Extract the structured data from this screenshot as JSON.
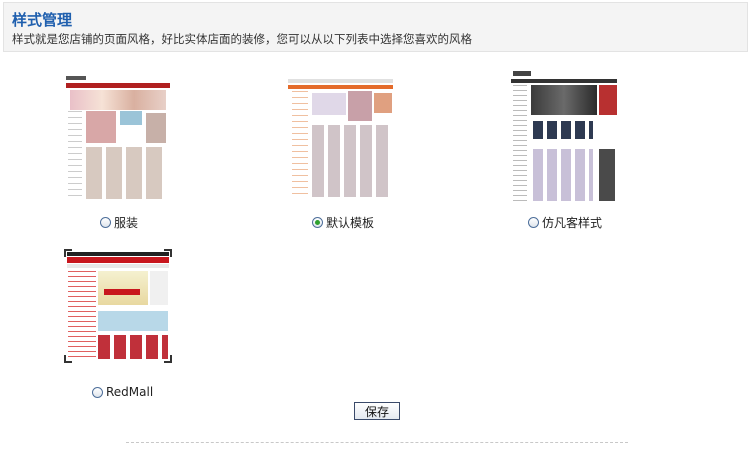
{
  "header": {
    "title": "样式管理",
    "subtitle": "样式就是您店铺的页面风格，好比实体店面的装修，您可以从以下列表中选择您喜欢的风格"
  },
  "styles": [
    {
      "label": "服装",
      "selected": false,
      "thumb": "clothing-style-preview"
    },
    {
      "label": "默认模板",
      "selected": true,
      "thumb": "default-template-preview"
    },
    {
      "label": "仿凡客样式",
      "selected": false,
      "thumb": "vancl-style-preview"
    },
    {
      "label": "RedMall",
      "selected": false,
      "thumb": "redmall-style-preview"
    }
  ],
  "actions": {
    "save_label": "保存"
  },
  "colors": {
    "title": "#1f5fae",
    "header_bg": "#f4f4f4",
    "selected_radio": "#2da02d"
  }
}
